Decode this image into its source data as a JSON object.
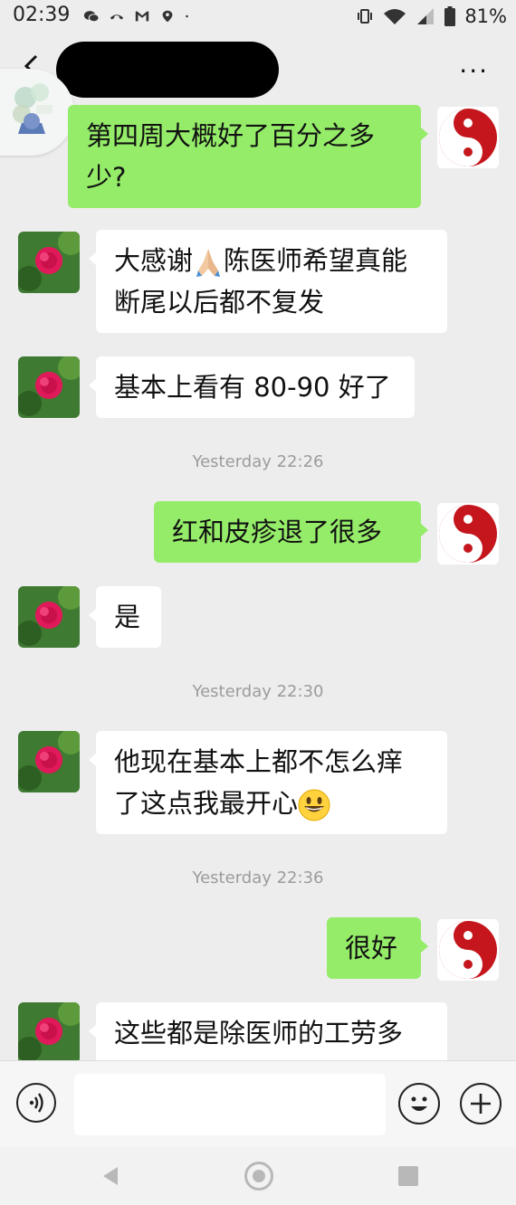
{
  "status_bar": {
    "time": "02:39",
    "battery": "81%"
  },
  "header": {
    "more_label": "···"
  },
  "avatars": {
    "contact": "peony-flower",
    "self": "yin-yang-logo"
  },
  "messages": [
    {
      "type": "out",
      "text": "第四周大概好了百分之多少?"
    },
    {
      "type": "in",
      "line1": "大感谢",
      "line1b": "陈医师希望真能",
      "line2": "断尾以后都不复发",
      "emoji": "folded-hands"
    },
    {
      "type": "in",
      "text": "基本上看有 80-90 好了"
    },
    {
      "type": "time",
      "text": "Yesterday 22:26"
    },
    {
      "type": "out",
      "text": "红和皮疹退了很多"
    },
    {
      "type": "in",
      "text": "是"
    },
    {
      "type": "time",
      "text": "Yesterday 22:30"
    },
    {
      "type": "in",
      "line1": "他现在基本上都不怎么痒",
      "line2": "了这点我最开心",
      "emoji": "grinning-face"
    },
    {
      "type": "time",
      "text": "Yesterday 22:36"
    },
    {
      "type": "out",
      "text": "很好"
    },
    {
      "type": "in",
      "text": "这些都是除医师的工劳多"
    }
  ],
  "colors": {
    "background": "#ededed",
    "outgoing_bubble": "#95ec69",
    "incoming_bubble": "#ffffff",
    "timestamp": "#9c9c9c"
  }
}
